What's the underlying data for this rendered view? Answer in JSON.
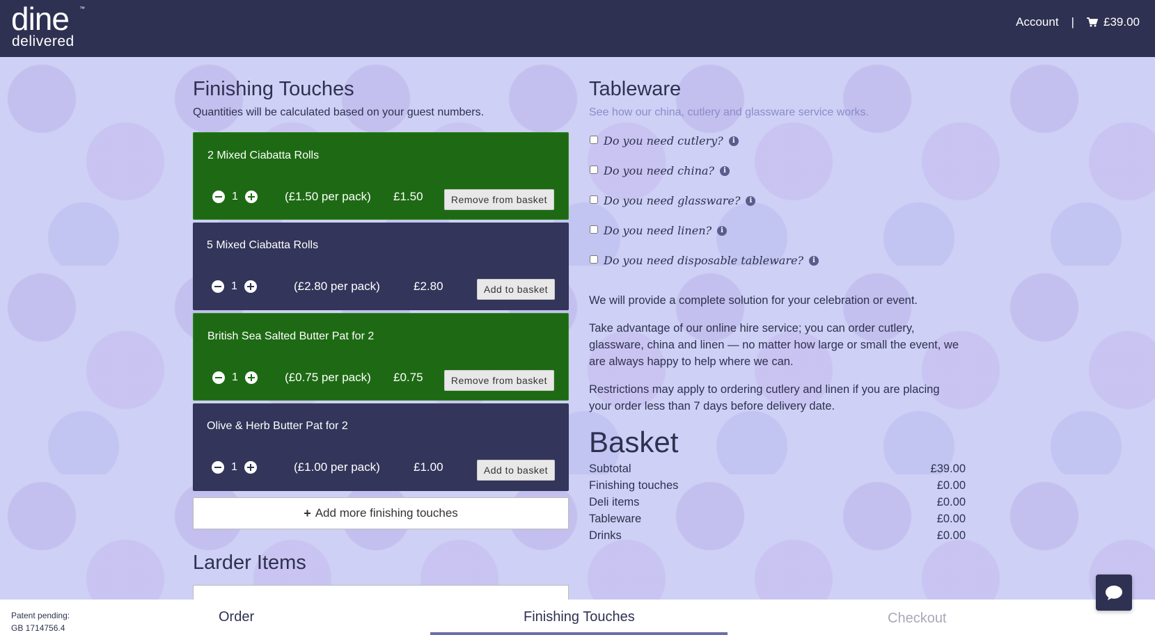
{
  "brand": {
    "logo_top": "dine",
    "logo_bottom": "delivered",
    "tm": "™"
  },
  "header": {
    "account_label": "Account",
    "separator": "|",
    "cart_total": "£39.00",
    "cart_icon": "cart-icon"
  },
  "finishing_touches": {
    "title": "Finishing Touches",
    "subtitle": "Quantities will be calculated based on your guest numbers.",
    "products": [
      {
        "name": "2 Mixed Ciabatta Rolls",
        "qty": "1",
        "per_pack": "(£1.50 per pack)",
        "price": "£1.50",
        "action": "Remove from basket",
        "in_basket": true
      },
      {
        "name": "5 Mixed Ciabatta Rolls",
        "qty": "1",
        "per_pack": "(£2.80 per pack)",
        "price": "£2.80",
        "action": "Add to basket",
        "in_basket": false
      },
      {
        "name": "British Sea Salted Butter Pat for 2",
        "qty": "1",
        "per_pack": "(£0.75 per pack)",
        "price": "£0.75",
        "action": "Remove from basket",
        "in_basket": true
      },
      {
        "name": "Olive & Herb Butter Pat for 2",
        "qty": "1",
        "per_pack": "(£1.00 per pack)",
        "price": "£1.00",
        "action": "Add to basket",
        "in_basket": false
      }
    ],
    "add_more_label": "Add more finishing touches"
  },
  "larder": {
    "title": "Larder Items"
  },
  "tableware": {
    "title": "Tableware",
    "subtitle": "See how our china, cutlery and glassware service works.",
    "options": [
      {
        "label": "Do you need cutlery?",
        "checked": false
      },
      {
        "label": "Do you need china?",
        "checked": false
      },
      {
        "label": "Do you need glassware?",
        "checked": false
      },
      {
        "label": "Do you need linen?",
        "checked": false
      },
      {
        "label": "Do you need disposable tableware?",
        "checked": false
      }
    ],
    "paragraphs": [
      "We will provide a complete solution for your celebration or event.",
      "Take advantage of our online hire service; you can order cutlery, glassware, china and linen — no matter how large or small the event, we are always happy to help where we can.",
      "Restrictions may apply to ordering cutlery and linen if you are placing your order less than 7 days before delivery date."
    ]
  },
  "basket": {
    "title": "Basket",
    "rows": [
      {
        "label": "Subtotal",
        "value": "£39.00"
      },
      {
        "label": "Finishing touches",
        "value": "£0.00"
      },
      {
        "label": "Deli items",
        "value": "£0.00"
      },
      {
        "label": "Tableware",
        "value": "£0.00"
      },
      {
        "label": "Drinks",
        "value": "£0.00"
      }
    ]
  },
  "footer": {
    "patent_line1": "Patent pending:",
    "patent_line2": "GB 1714756.4",
    "steps": [
      "Order",
      "Finishing Touches",
      "Checkout"
    ],
    "active_step": "Finishing Touches"
  },
  "colors": {
    "header_bg": "#2f3152",
    "in_basket_card": "#1e6a14",
    "default_card": "#33355a",
    "page_bg": "#cfd0f5",
    "muted_link": "#8a8cc9"
  }
}
